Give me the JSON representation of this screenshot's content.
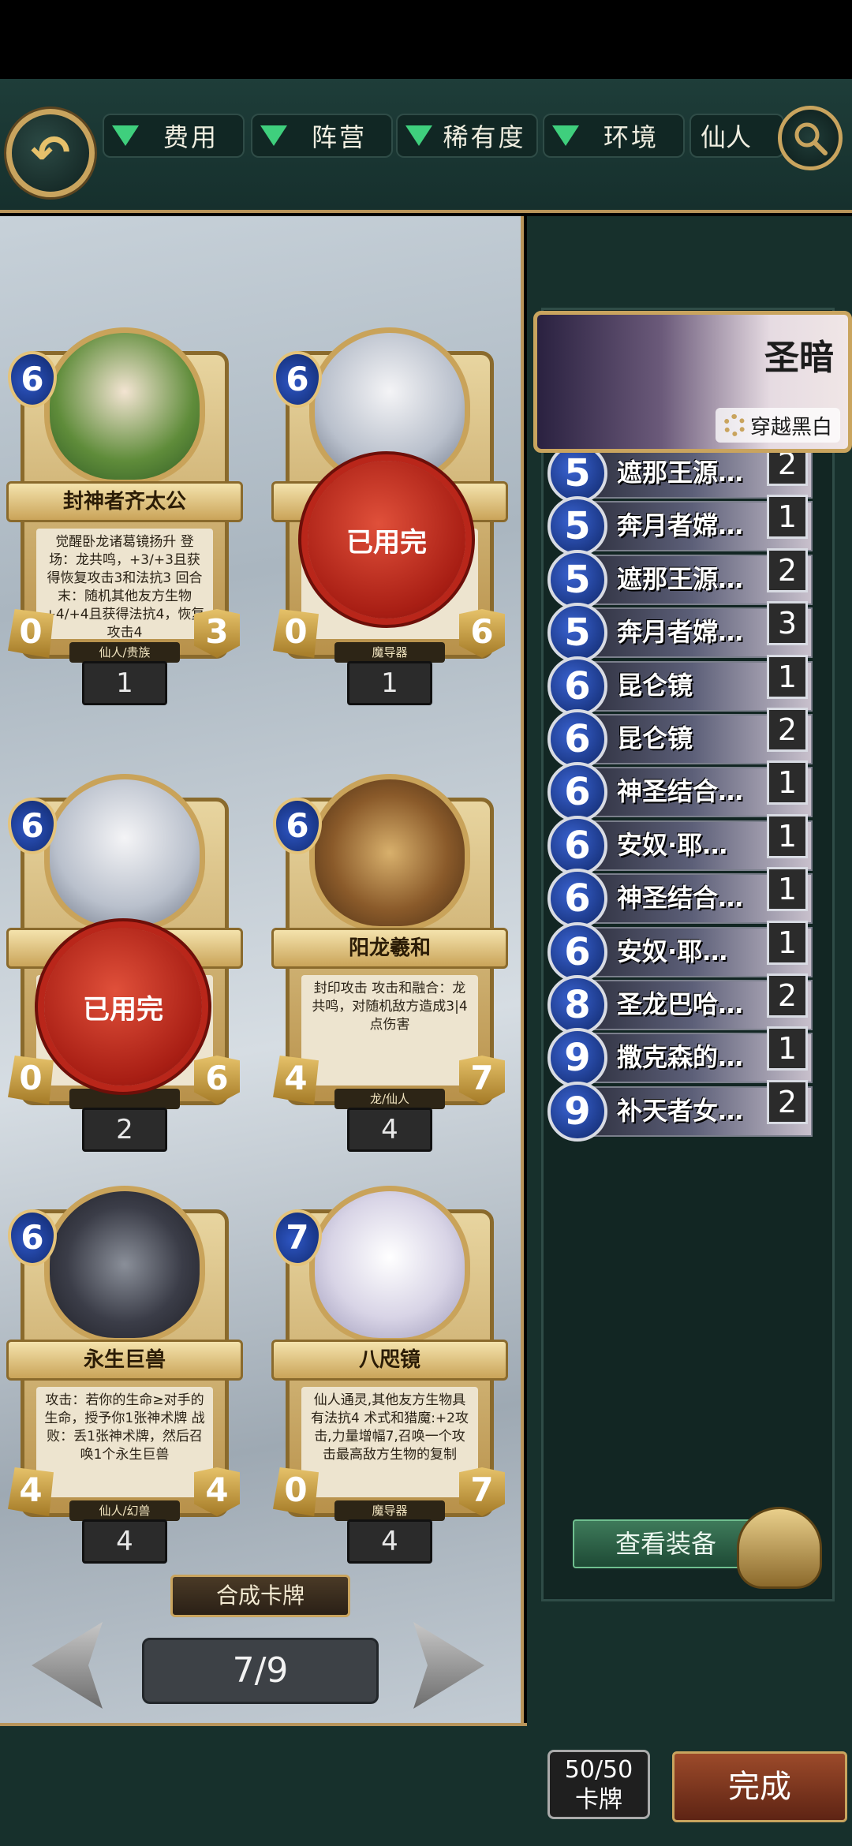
{
  "filters": {
    "cost": "费用",
    "faction": "阵营",
    "rarity": "稀有度",
    "environment": "环境",
    "search_value": "仙人"
  },
  "cards": [
    {
      "name": "封神者齐太公",
      "cost": "6",
      "attack": "0",
      "health": "3",
      "count": "1",
      "desc": "觉醒卧龙诸葛镜扬升 登场：龙共鸣，+3/+3且获得恢复攻击3和法抗3 回合末：随机其他友方生物+4/+4且获得法抗4，恢复攻击4",
      "tribe": "仙人/贵族",
      "used_up": false
    },
    {
      "name": "",
      "cost": "6",
      "attack": "0",
      "health": "6",
      "count": "1",
      "desc": "",
      "tribe": "魔导器",
      "used_up": true
    },
    {
      "name": "",
      "cost": "6",
      "attack": "0",
      "health": "6",
      "count": "2",
      "desc": "",
      "tribe": "",
      "used_up": true
    },
    {
      "name": "阳龙羲和",
      "cost": "6",
      "attack": "4",
      "health": "7",
      "count": "4",
      "desc": "封印攻击 攻击和融合：龙共鸣，对随机敌方造成3|4点伤害",
      "tribe": "龙/仙人",
      "used_up": false
    },
    {
      "name": "永生巨兽",
      "cost": "6",
      "attack": "4",
      "health": "4",
      "count": "4",
      "desc": "攻击：若你的生命≥对手的生命，授予你1张神术牌 战败：丢1张神术牌，然后召唤1个永生巨兽",
      "tribe": "仙人/幻兽",
      "used_up": false
    },
    {
      "name": "八咫镜",
      "cost": "7",
      "attack": "0",
      "health": "7",
      "count": "4",
      "desc": "仙人通灵,其他友方生物具有法抗4 术式和猎魔:+2攻击,力量增幅7,召唤一个攻击最高敌方生物的复制",
      "tribe": "魔导器",
      "used_up": false
    }
  ],
  "stamp_text": "已用完",
  "craft_label": "合成卡牌",
  "pager": "7/9",
  "hero": {
    "name": "圣暗",
    "tag": "穿越黑白"
  },
  "deck": [
    {
      "cost": "5",
      "name": "遮那王源…",
      "count": "2"
    },
    {
      "cost": "5",
      "name": "奔月者嫦…",
      "count": "1"
    },
    {
      "cost": "5",
      "name": "遮那王源…",
      "count": "2"
    },
    {
      "cost": "5",
      "name": "奔月者嫦…",
      "count": "3"
    },
    {
      "cost": "6",
      "name": "昆仑镜",
      "count": "1"
    },
    {
      "cost": "6",
      "name": "昆仑镜",
      "count": "2"
    },
    {
      "cost": "6",
      "name": "神圣结合…",
      "count": "1"
    },
    {
      "cost": "6",
      "name": "安奴·耶…",
      "count": "1"
    },
    {
      "cost": "6",
      "name": "神圣结合…",
      "count": "1"
    },
    {
      "cost": "6",
      "name": "安奴·耶…",
      "count": "1"
    },
    {
      "cost": "8",
      "name": "圣龙巴哈…",
      "count": "2"
    },
    {
      "cost": "9",
      "name": "撒克森的…",
      "count": "1"
    },
    {
      "cost": "9",
      "name": "补天者女…",
      "count": "2"
    }
  ],
  "equip_label": "查看装备",
  "deck_count": {
    "value": "50/50",
    "label": "卡牌"
  },
  "done_label": "完成",
  "colors": {
    "accent_gold": "#c9a45e",
    "panel_green": "#17302c",
    "filter_triangle": "#3fcf7d",
    "stamp_red": "#b9261a"
  }
}
